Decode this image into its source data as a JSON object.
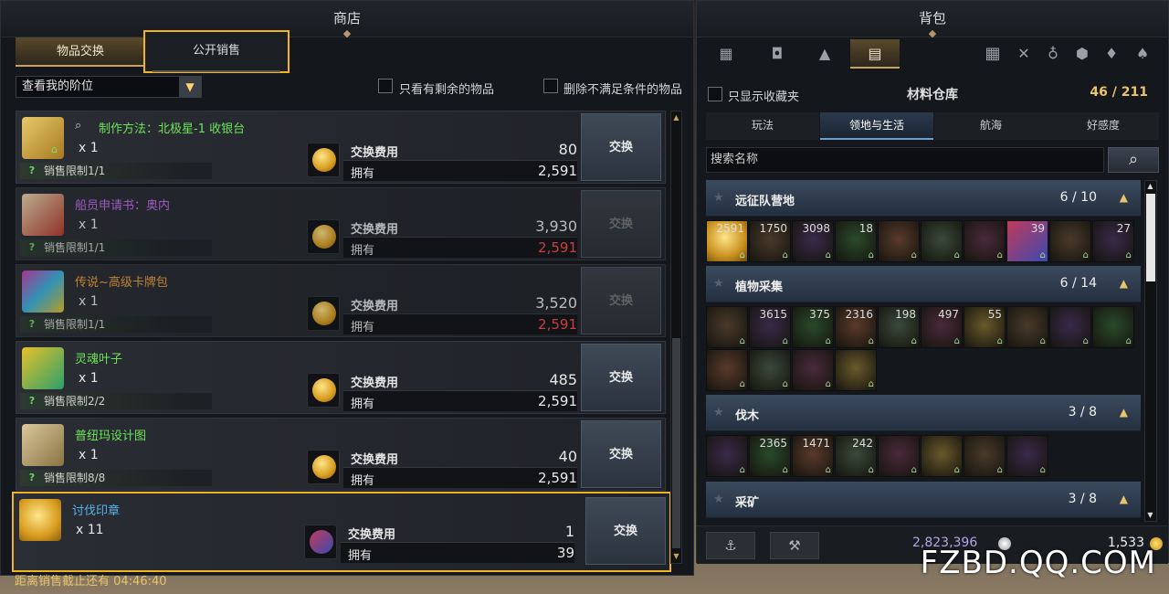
{
  "shop": {
    "title": "商店",
    "tabs": {
      "exchange": "物品交换",
      "public_sale": "公开销售"
    },
    "dropdown": "查看我的阶位",
    "filter_remaining": "只看有剩余的物品",
    "filter_remove_unmet": "删除不满足条件的物品",
    "cost_label": "交换费用",
    "own_label": "拥有",
    "countdown": "距离销售截止还有 04:46:40",
    "items": [
      {
        "name": "制作方法：北极星-1 收银台",
        "name_color": "#6ee35a",
        "qty": "x 1",
        "limit": "销售限制1/1",
        "cost": "80",
        "own": "2,591",
        "own_color": "#e8e8e8",
        "button": "交换",
        "enabled": true
      },
      {
        "name": "船员申请书：奥内",
        "name_color": "#c46cf0",
        "qty": "x 1",
        "limit": "销售限制1/1",
        "cost": "3,930",
        "own": "2,591",
        "own_color": "#ff4a4a",
        "button": "交换",
        "enabled": false
      },
      {
        "name": "传说~高级卡牌包",
        "name_color": "#f0a23a",
        "qty": "x 1",
        "limit": "销售限制1/1",
        "cost": "3,520",
        "own": "2,591",
        "own_color": "#ff4a4a",
        "button": "交换",
        "enabled": false
      },
      {
        "name": "灵魂叶子",
        "name_color": "#6ee35a",
        "qty": "x 1",
        "limit": "销售限制2/2",
        "cost": "485",
        "own": "2,591",
        "own_color": "#e8e8e8",
        "button": "交换",
        "enabled": true
      },
      {
        "name": "普纽玛设计图",
        "name_color": "#6ee35a",
        "qty": "x 1",
        "limit": "销售限制8/8",
        "cost": "40",
        "own": "2,591",
        "own_color": "#e8e8e8",
        "button": "交换",
        "enabled": true
      },
      {
        "name": "讨伐印章",
        "name_color": "#56b4f0",
        "qty": "x 11",
        "limit": "",
        "cost": "1",
        "own": "39",
        "own_color": "#e8e8e8",
        "button": "交换",
        "enabled": true
      }
    ]
  },
  "bag": {
    "title": "背包",
    "show_favorites": "只显示收藏夹",
    "storage_title": "材料仓库",
    "count": "46 / 211",
    "subtabs": [
      "玩法",
      "领地与生活",
      "航海",
      "好感度"
    ],
    "search_placeholder": "搜索名称",
    "categories": [
      {
        "name": "远征队营地",
        "count": "6 / 10",
        "slots": [
          "2591",
          "1750",
          "3098",
          "18",
          "",
          "",
          "",
          "39",
          "",
          "27"
        ]
      },
      {
        "name": "植物采集",
        "count": "6 / 14",
        "slots": [
          "",
          "3615",
          "375",
          "2316",
          "198",
          "497",
          "55",
          "",
          "",
          "",
          "",
          "",
          "",
          ""
        ]
      },
      {
        "name": "伐木",
        "count": "3 / 8",
        "slots": [
          "",
          "2365",
          "1471",
          "242",
          "",
          "",
          "",
          ""
        ]
      },
      {
        "name": "采矿",
        "count": "3 / 8",
        "slots": []
      }
    ],
    "silver": "2,823,396",
    "gold": "1,533"
  },
  "watermark": "FZBD.QQ.COM"
}
